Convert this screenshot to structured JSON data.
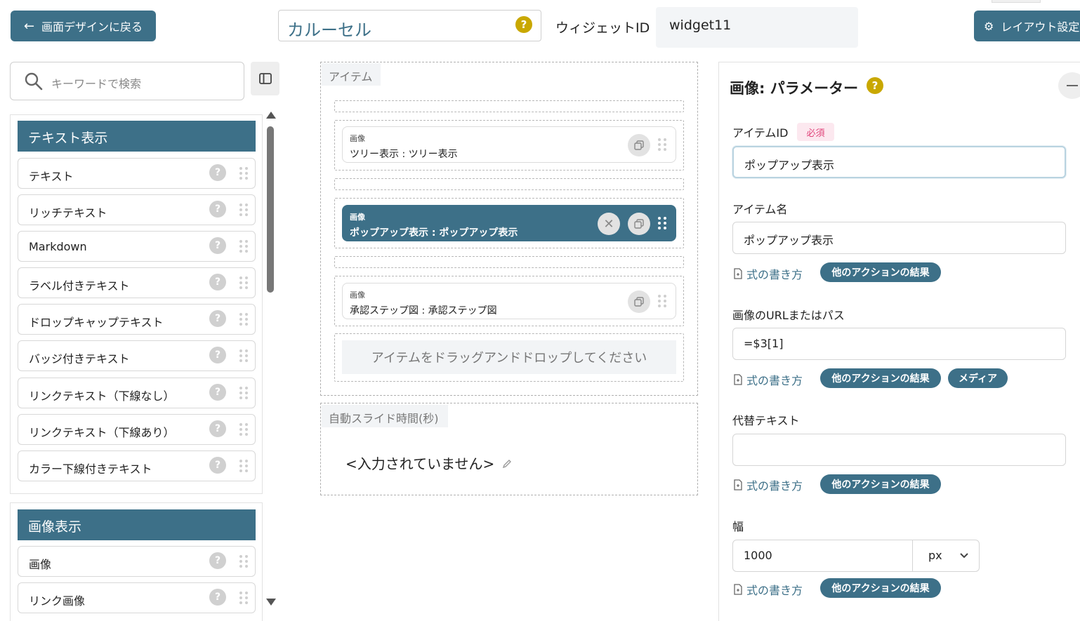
{
  "header": {
    "back_button": "画面デザインに戻る",
    "widget_type": "カルーセル",
    "widget_id_label": "ウィジェットID",
    "widget_id_value": "widget11",
    "layout_button": "レイアウト設定"
  },
  "palette": {
    "search_placeholder": "キーワードで検索",
    "groups": [
      {
        "title": "テキスト表示",
        "items": [
          "テキスト",
          "リッチテキスト",
          "Markdown",
          "ラベル付きテキスト",
          "ドロップキャップテキスト",
          "バッジ付きテキスト",
          "リンクテキスト（下線なし）",
          "リンクテキスト（下線あり）",
          "カラー下線付きテキスト"
        ]
      },
      {
        "title": "画像表示",
        "items": [
          "画像",
          "リンク画像"
        ]
      }
    ]
  },
  "canvas": {
    "items_section_label": "アイテム",
    "cards": [
      {
        "type": "画像",
        "name": "ツリー表示 : ツリー表示"
      },
      {
        "type": "画像",
        "name": "ポップアップ表示 : ポップアップ表示"
      },
      {
        "type": "画像",
        "name": "承認ステップ図 : 承認ステップ図"
      }
    ],
    "drop_hint": "アイテムをドラッグアンドドロップしてください",
    "autoslide_label": "自動スライド時間(秒)",
    "autoslide_value": "<入力されていません>"
  },
  "params": {
    "title": "画像: パラメーター",
    "item_id_label": "アイテムID",
    "required_badge": "必須",
    "item_id_value": "ポップアップ表示",
    "item_name_label": "アイテム名",
    "item_name_value": "ポップアップ表示",
    "formula_link": "式の書き方",
    "other_action_result": "他のアクションの結果",
    "media": "メディア",
    "url_label": "画像のURLまたはパス",
    "url_value": "=$3[1]",
    "alt_label": "代替テキスト",
    "alt_value": "",
    "width_label": "幅",
    "width_value": "1000",
    "width_unit": "px"
  },
  "colors": {
    "primary": "#3d7088",
    "help_yellow": "#c9a800",
    "required_pink": "#e0457b"
  }
}
